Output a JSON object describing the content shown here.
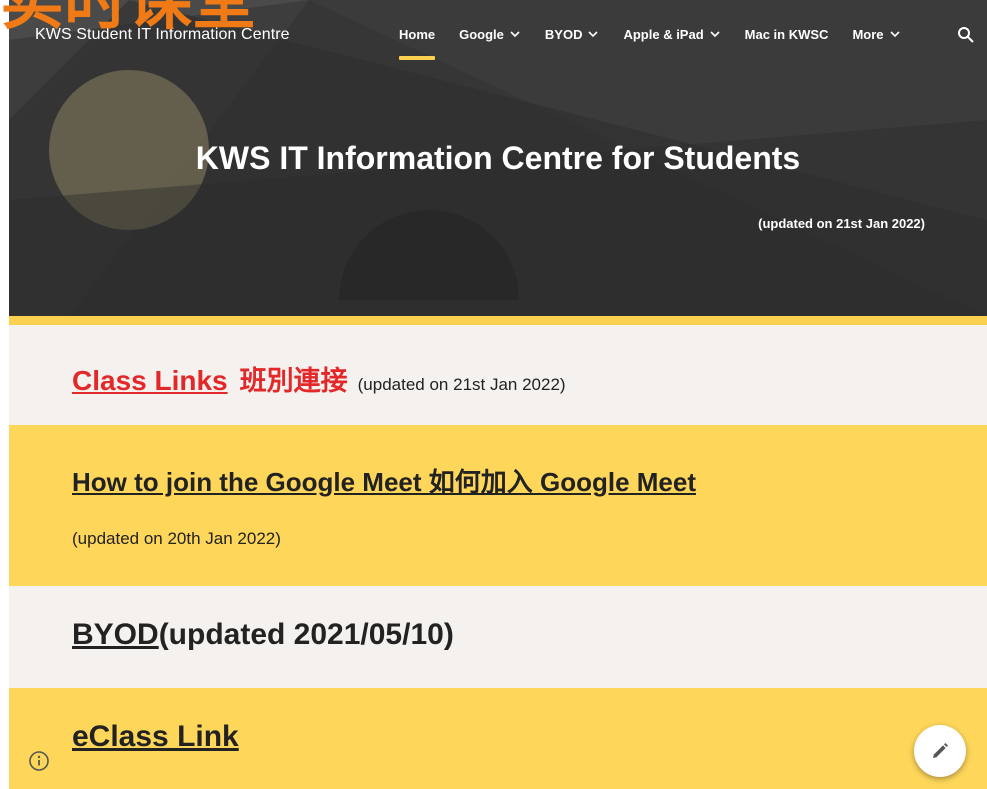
{
  "header": {
    "site_title": "KWS Student IT Information Centre",
    "nav": [
      {
        "label": "Home",
        "active": true,
        "has_dropdown": false
      },
      {
        "label": "Google",
        "active": false,
        "has_dropdown": true
      },
      {
        "label": "BYOD",
        "active": false,
        "has_dropdown": true
      },
      {
        "label": "Apple & iPad",
        "active": false,
        "has_dropdown": true
      },
      {
        "label": "Mac in KWSC",
        "active": false,
        "has_dropdown": false
      },
      {
        "label": "More",
        "active": false,
        "has_dropdown": true
      }
    ],
    "search_icon": "search-icon"
  },
  "hero": {
    "title": "KWS IT Information Centre for Students",
    "subtitle": "(updated on 21st Jan 2022)"
  },
  "sections": {
    "class_links": {
      "link": "Class Links",
      "chinese": "班別連接",
      "updated": "(updated on 21st Jan 2022)"
    },
    "google_meet": {
      "link": "How to join the Google Meet 如何加入 Google Meet",
      "updated": "(updated on 20th Jan 2022)"
    },
    "byod": {
      "link": "BYOD",
      "updated": "(updated 2021/05/10)"
    },
    "eclass": {
      "link": "eClass Link"
    }
  },
  "overlay_text": "实时课堂",
  "colors": {
    "accent_yellow": "#fdd04f",
    "section_yellow": "#fdd65a",
    "section_light": "#f4f1ee",
    "link_red": "#e3282a",
    "hero_bg": "#3a3a3a",
    "overlay_orange": "#f07a16"
  },
  "floating": {
    "info_icon": "info-icon",
    "edit_icon": "pencil-icon"
  }
}
